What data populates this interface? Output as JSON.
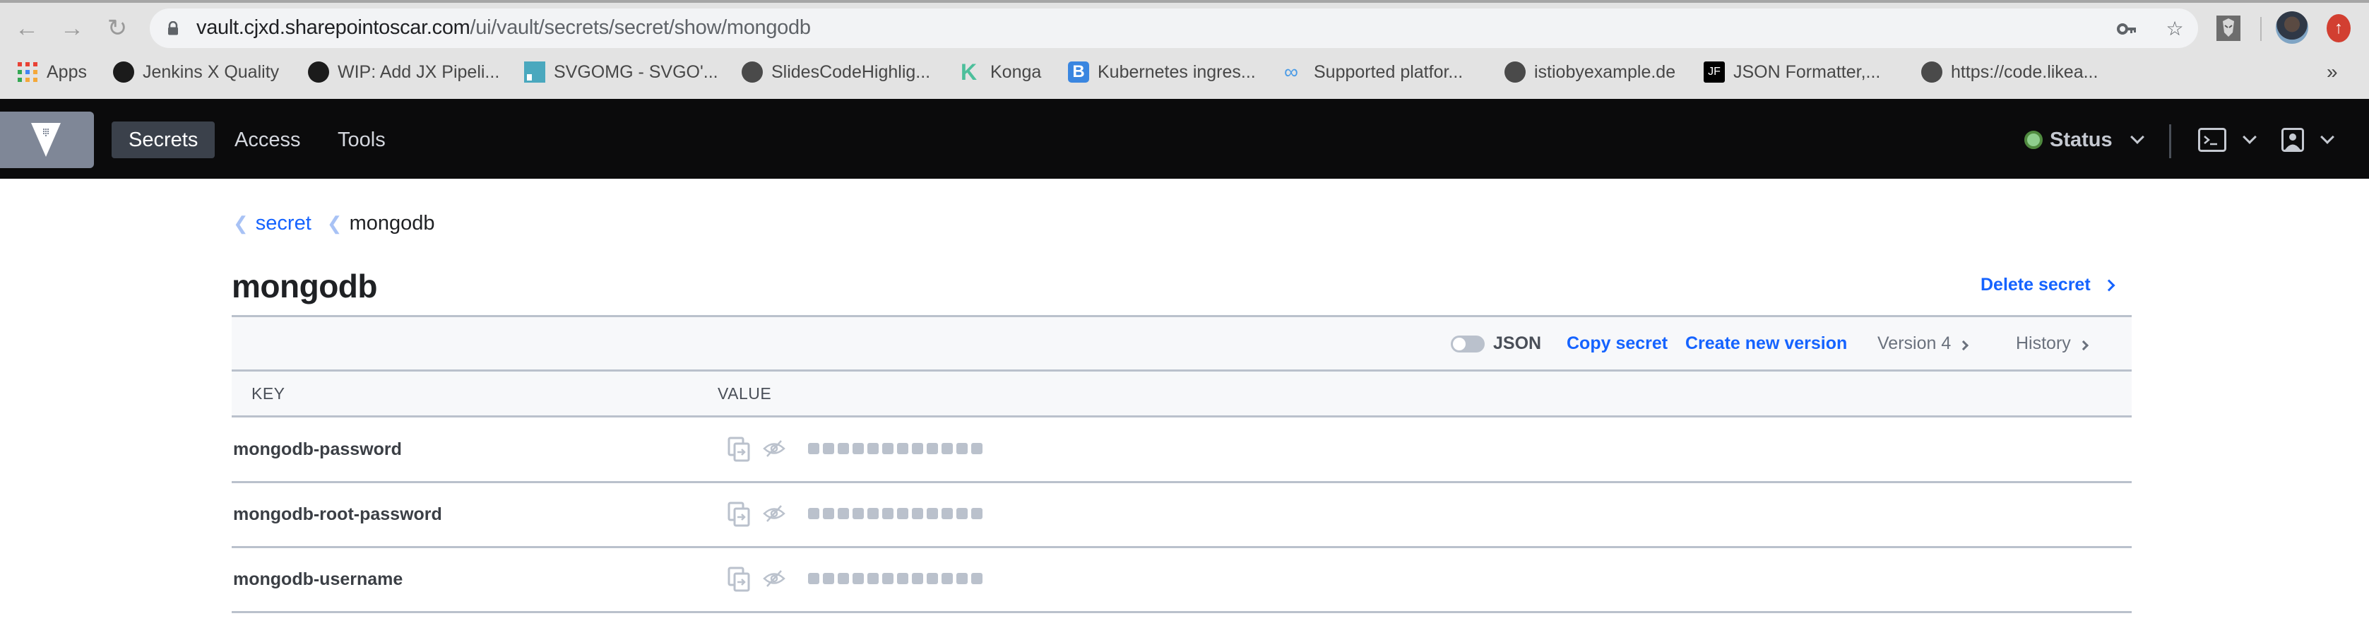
{
  "browser": {
    "url_host": "vault.cjxd.sharepointoscar.com",
    "url_path": "/ui/vault/secrets/secret/show/mongodb",
    "icons": [
      "back-icon",
      "forward-icon",
      "reload-icon",
      "lock-icon",
      "key-icon",
      "star-icon",
      "extension-icon",
      "profile-avatar",
      "update-icon"
    ],
    "bookmarks": [
      {
        "label": "Apps",
        "icon": "apps-grid-icon"
      },
      {
        "label": "Jenkins X Quality",
        "icon": "github-icon"
      },
      {
        "label": "WIP: Add JX Pipeli...",
        "icon": "github-icon"
      },
      {
        "label": "SVGOMG - SVGO'...",
        "icon": "svgomg-icon"
      },
      {
        "label": "SlidesCodeHighlig...",
        "icon": "globe-icon"
      },
      {
        "label": "Konga",
        "icon": "konga-icon"
      },
      {
        "label": "Kubernetes ingres...",
        "icon": "bootstrap-icon"
      },
      {
        "label": "Supported platfor...",
        "icon": "link-icon"
      },
      {
        "label": "istiobyexample.de",
        "icon": "globe-icon"
      },
      {
        "label": "JSON Formatter,...",
        "icon": "jf-icon"
      },
      {
        "label": "https://code.likea...",
        "icon": "globe-icon"
      }
    ],
    "bookmarks_overflow": "»"
  },
  "vault_nav": {
    "items": [
      {
        "label": "Secrets",
        "active": true
      },
      {
        "label": "Access",
        "active": false
      },
      {
        "label": "Tools",
        "active": false
      }
    ],
    "status_label": "Status",
    "status_color": "#8fcf8e"
  },
  "breadcrumb": {
    "parent": "secret",
    "current": "mongodb"
  },
  "page": {
    "title": "mongodb",
    "delete_label": "Delete secret"
  },
  "toolbar": {
    "json_label": "JSON",
    "json_toggle_on": false,
    "copy_label": "Copy secret",
    "create_label": "Create new version",
    "version_label": "Version 4",
    "history_label": "History"
  },
  "table": {
    "headers": {
      "key": "KEY",
      "value": "VALUE"
    },
    "rows": [
      {
        "key": "mongodb-password",
        "masked_length": 12
      },
      {
        "key": "mongodb-root-password",
        "masked_length": 12
      },
      {
        "key": "mongodb-username",
        "masked_length": 12
      }
    ]
  },
  "colors": {
    "accent_blue": "#1563ff",
    "nav_bg": "#0b0b0c",
    "border": "#bac1cc"
  }
}
